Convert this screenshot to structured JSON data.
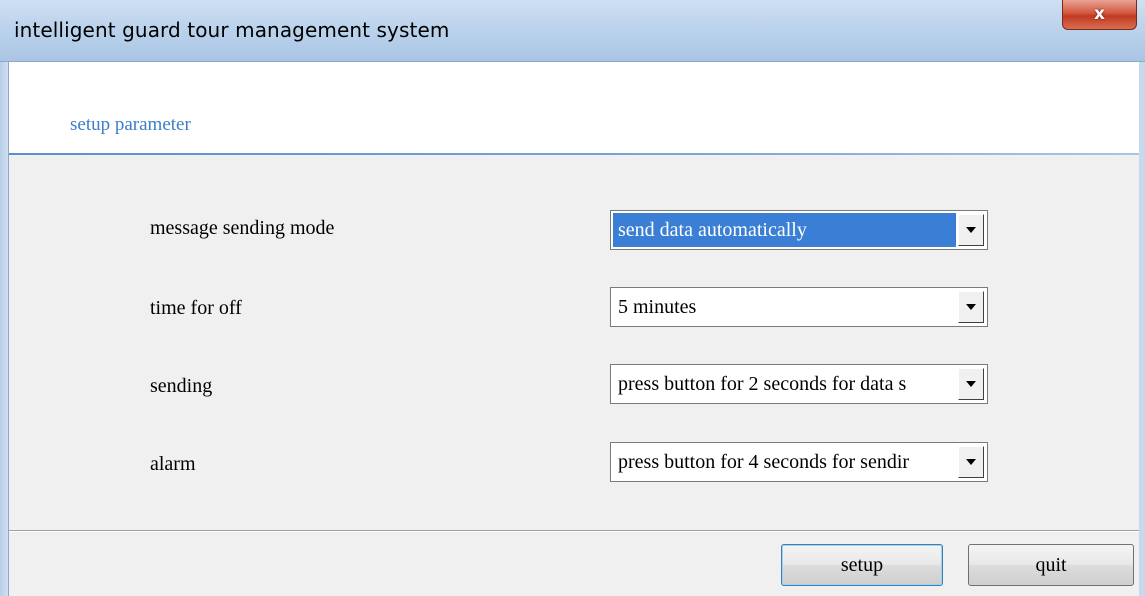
{
  "window": {
    "title": "intelligent guard tour management system",
    "close_label": "x"
  },
  "header": {
    "title": "setup parameter"
  },
  "fields": [
    {
      "label": "message sending mode",
      "value": "send data automatically",
      "selected": true
    },
    {
      "label": "time for off",
      "value": "5 minutes",
      "selected": false
    },
    {
      "label": "sending",
      "value": "press button for 2 seconds for data s",
      "selected": false
    },
    {
      "label": "alarm",
      "value": "press button for 4 seconds for sendir",
      "selected": false
    }
  ],
  "buttons": {
    "setup": "setup",
    "quit": "quit"
  },
  "colors": {
    "accent": "#3c7fc8",
    "selection": "#3a7fd5",
    "close_button": "#c23a20"
  }
}
